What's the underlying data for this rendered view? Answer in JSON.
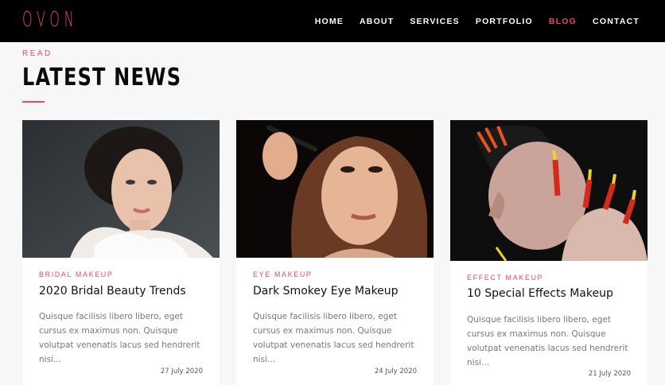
{
  "logo": "OVON",
  "nav": {
    "items": [
      {
        "label": "HOME"
      },
      {
        "label": "ABOUT"
      },
      {
        "label": "SERVICES"
      },
      {
        "label": "PORTFOLIO"
      },
      {
        "label": "BLOG"
      },
      {
        "label": "CONTACT"
      }
    ],
    "active": "BLOG"
  },
  "section": {
    "sub_label": "READ",
    "title": "LATEST NEWS"
  },
  "colors": {
    "accent": "#e24a6e",
    "nav_bg": "#000000",
    "page_bg": "#f7f7f7"
  },
  "posts": [
    {
      "image": "portrait-woman-lace",
      "category": "BRIDAL MAKEUP",
      "title": "2020 Bridal Beauty Trends",
      "excerpt": "Quisque facilisis libero libero, eget cursus ex maximus non. Quisque volutpat venenatis lacus sed hendrerit nisi...",
      "date": "27 July 2020"
    },
    {
      "image": "portrait-woman-mascara",
      "category": "EYE MAKEUP",
      "title": "Dark Smokey Eye Makeup",
      "excerpt": "Quisque facilisis libero libero, eget cursus ex maximus non. Quisque volutpat venenatis lacus sed hendrerit nisi...",
      "date": "24 July 2020"
    },
    {
      "image": "portrait-woman-special-effects",
      "category": "EFFECT MAKEUP",
      "title": "10 Special Effects Makeup",
      "excerpt": "Quisque facilisis libero libero, eget cursus ex maximus non. Quisque volutpat venenatis lacus sed hendrerit nisi...",
      "date": "21 July 2020"
    }
  ]
}
